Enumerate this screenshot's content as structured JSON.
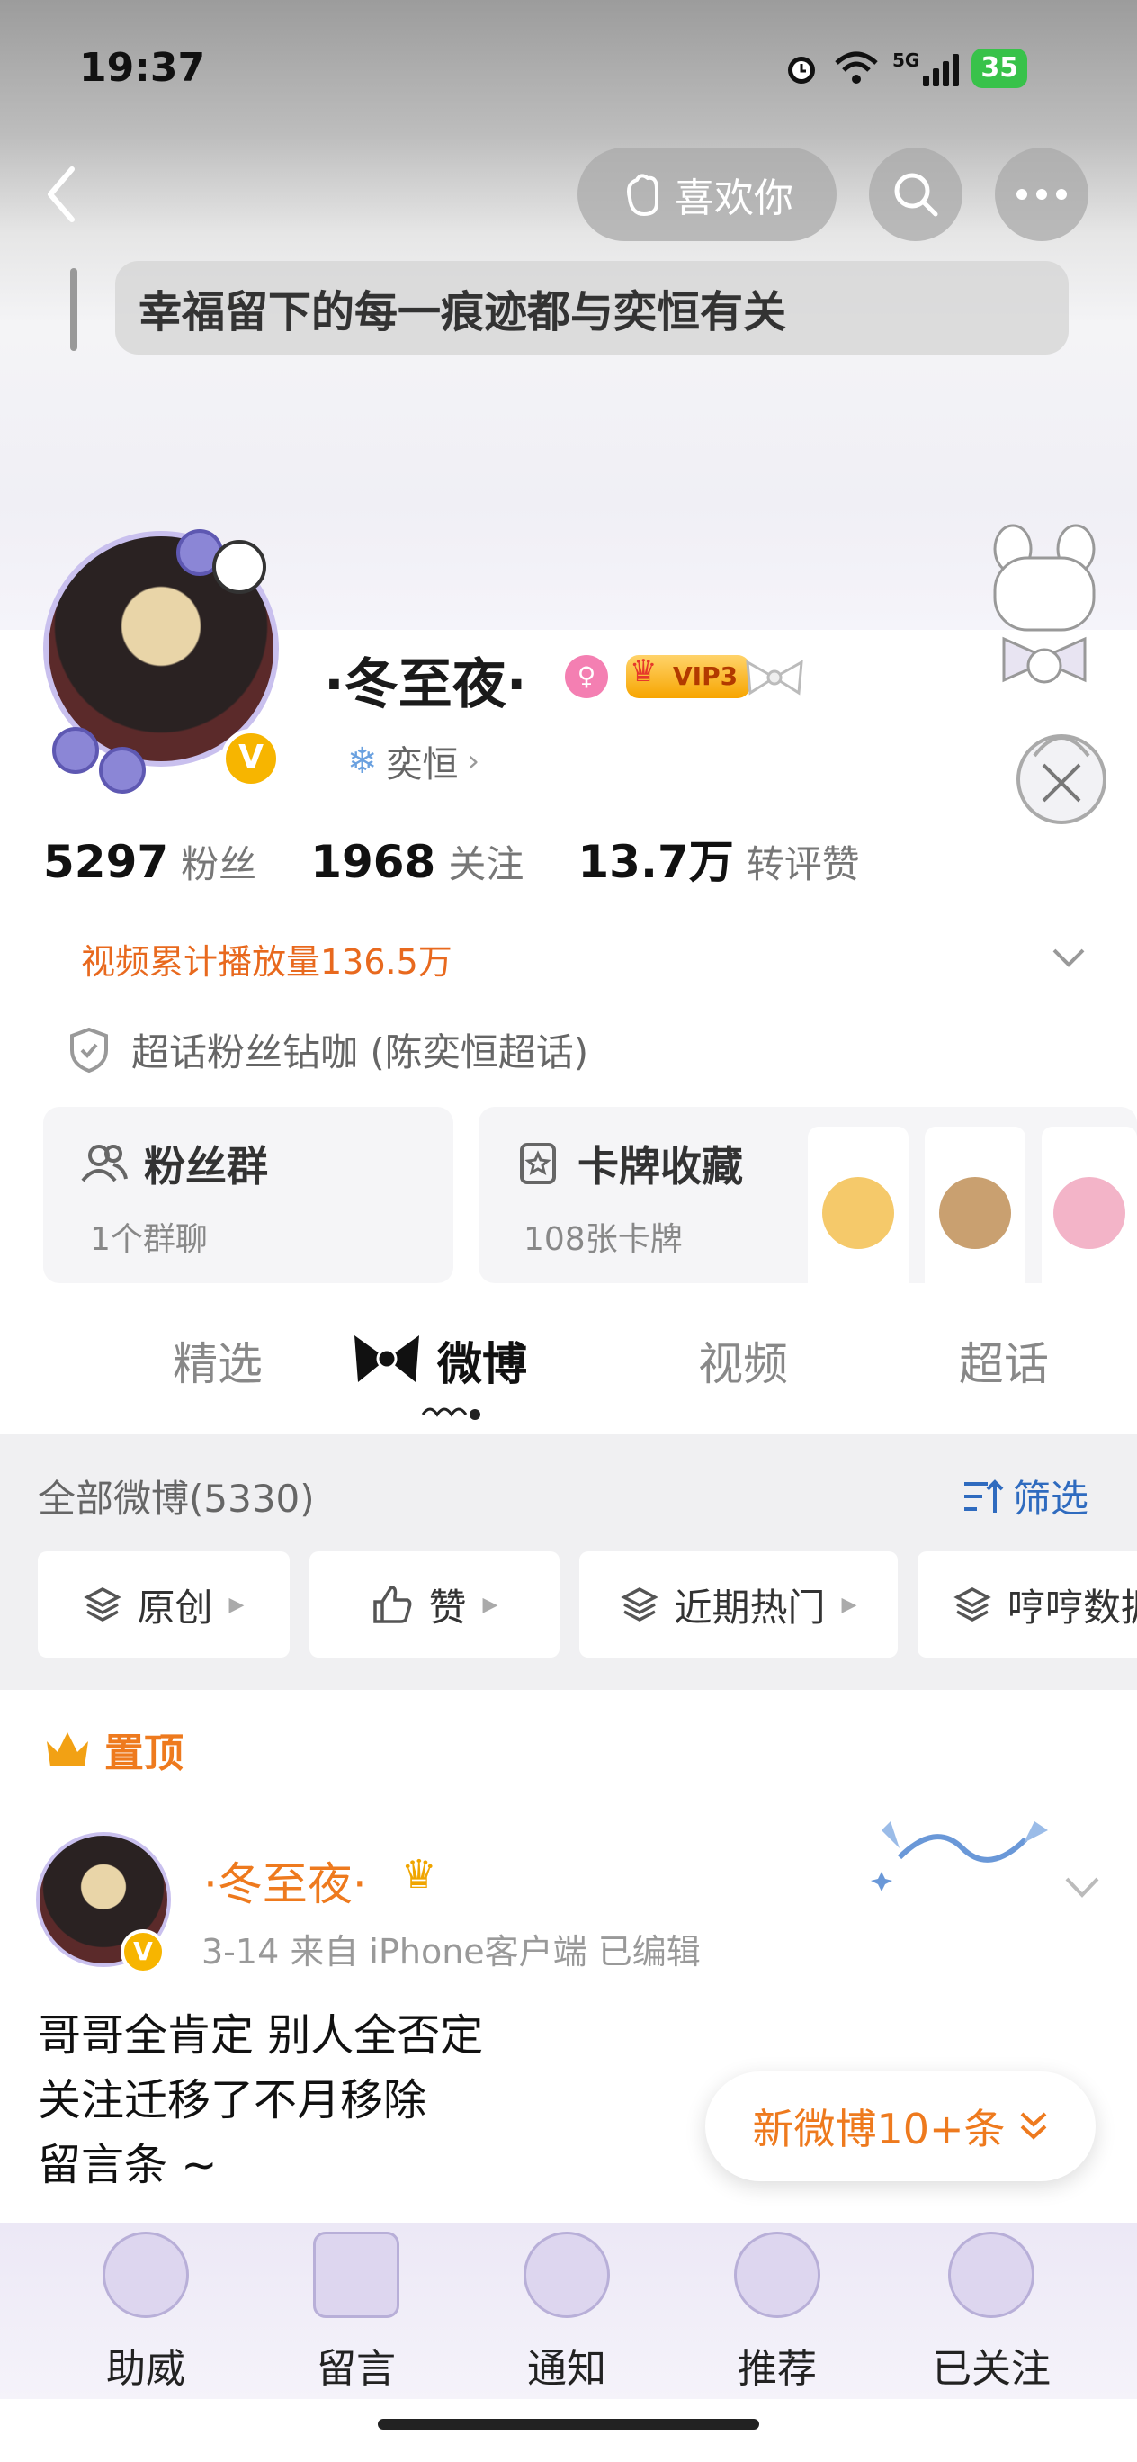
{
  "status_bar": {
    "time": "19:37",
    "network": "5G",
    "battery": "35"
  },
  "header": {
    "like_label": "喜欢你",
    "slogan": "幸福留下的每一痕迹都与奕恒有关"
  },
  "profile": {
    "name": "·冬至夜·",
    "vip_label": "VIP3",
    "verified_mark": "V",
    "topic": "奕恒",
    "stats": [
      {
        "num": "5297",
        "label": "粉丝"
      },
      {
        "num": "1968",
        "label": "关注"
      },
      {
        "num": "13.7万",
        "label": "转评赞"
      }
    ],
    "video_plays": "视频累计播放量136.5万",
    "superfan": "超话粉丝钻咖 (陈奕恒超话)"
  },
  "cards": {
    "fans_group": {
      "title": "粉丝群",
      "sub": "1个群聊"
    },
    "collection": {
      "title": "卡牌收藏",
      "sub": "108张卡牌"
    }
  },
  "tabs": [
    "精选",
    "微博",
    "视频",
    "超话"
  ],
  "filter": {
    "all_count": "全部微博(5330)",
    "filter_label": "筛选",
    "chips": [
      "原创",
      "赞",
      "近期热门",
      "哼哼数据"
    ]
  },
  "post": {
    "pin_label": "置顶",
    "author": "·冬至夜·",
    "meta": "3-14  来自 iPhone客户端  已编辑",
    "lines": [
      "哥哥全肯定 别人全否定",
      "关注迁移了不月移除",
      "留言条 ~"
    ]
  },
  "new_posts": "新微博10+条",
  "bottom_nav": [
    "助威",
    "留言",
    "通知",
    "推荐",
    "已关注"
  ],
  "colors": {
    "accent": "#ee7a1e",
    "link": "#2f6bbf",
    "vip": "#f7a500",
    "battery": "#38c24a"
  }
}
